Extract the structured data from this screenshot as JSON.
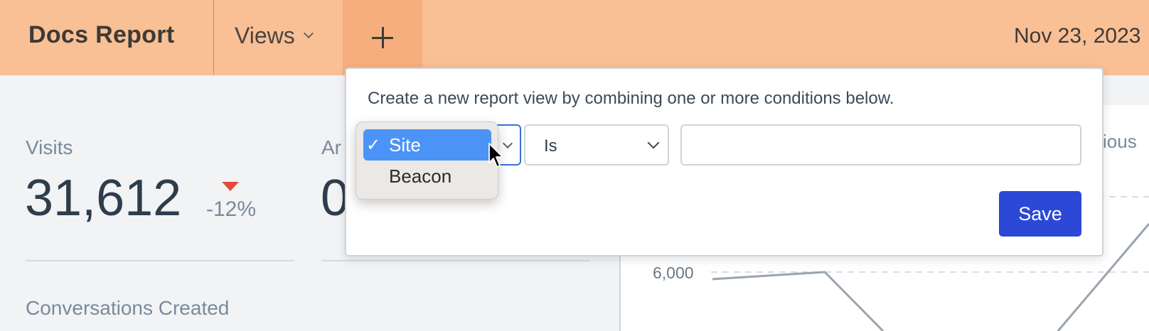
{
  "header": {
    "brand": "Docs Report",
    "views_label": "Views",
    "date": "Nov 23, 2023"
  },
  "stats": {
    "visits_label": "Visits",
    "visits_value": "31,612",
    "visits_delta": "-12%",
    "second_label": "Ar",
    "second_value": "0",
    "conversations_label": "Conversations Created"
  },
  "chart": {
    "legend_partial": "vious",
    "y_tick": "6,000"
  },
  "popover": {
    "description": "Create a new report view by combining one or more conditions below.",
    "condition_value": "Site",
    "operator_value": "Is",
    "input_value": "",
    "save_label": "Save"
  },
  "dropdown": {
    "options": [
      {
        "label": "Site",
        "check": "✓",
        "selected": true
      },
      {
        "label": "Beacon",
        "check": "",
        "selected": false
      }
    ]
  },
  "colors": {
    "header_bg": "#f9bf95",
    "plus_bg": "#f7ae7e",
    "save_bg": "#2b48d6",
    "selected_option_bg": "#4b93f6",
    "delta_down": "#e04b3d"
  }
}
